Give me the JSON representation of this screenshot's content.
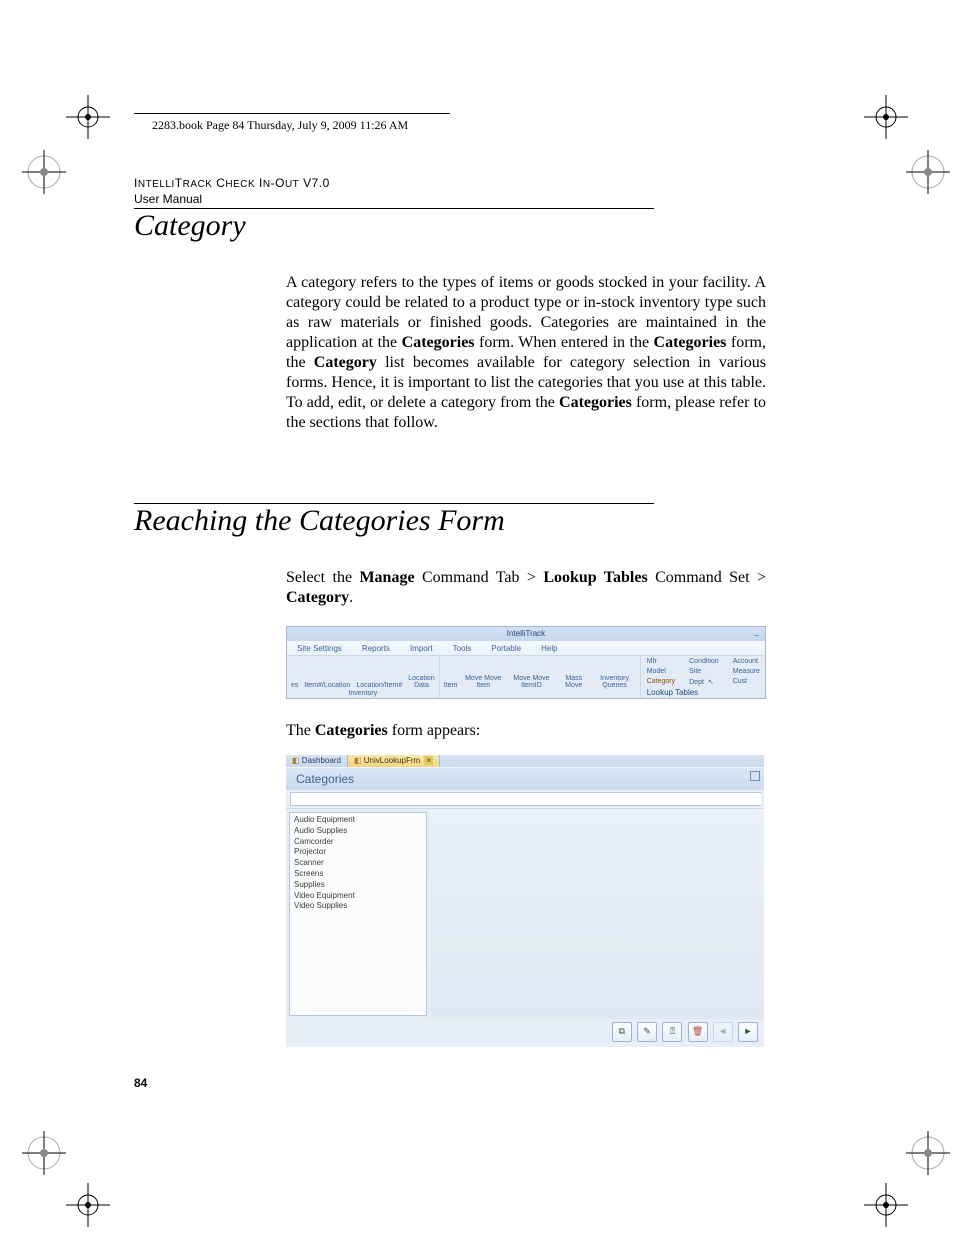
{
  "page_meta": {
    "book_line": "2283.book  Page 84  Thursday, July 9, 2009  11:26 AM",
    "product": "IntelliTrack Check In-Out v7.0",
    "subtitle": "User Manual",
    "page_number": "84"
  },
  "section1": {
    "heading": "Category",
    "para_html": "A category refers to the types of items or goods stocked in your facility. A category could be related to a product type or in-stock inventory type such as raw materials or finished goods. Categories are maintained in the application at the <b>Categories</b> form. When entered in the <b>Categories</b> form, the <b>Category</b> list becomes available for category selection in various forms. Hence, it is important to list the categories that you use at this table. To add, edit, or delete a category from the <b>Categories</b> form, please refer to the sections that follow."
  },
  "section2": {
    "heading": "Reaching the Categories Form",
    "para_html": "Select the <b>Manage</b> Command Tab > <b>Lookup Tables</b> Command Set > <b>Category</b>."
  },
  "ribbon": {
    "window_title": "IntelliTrack",
    "tabs": [
      "Site Settings",
      "Reports",
      "Import",
      "Tools",
      "Portable",
      "Help"
    ],
    "group_inventory": {
      "name": "Inventory",
      "items_left": [
        "es",
        "Item#/Location",
        "Location/Item#",
        "Location Data"
      ],
      "items_right": [
        "Item",
        "Move  Move Item",
        "Move Move ItemID",
        "Mass Move",
        "Inventory Queries"
      ]
    },
    "group_lookup": {
      "name": "Lookup Tables",
      "grid": [
        [
          "Mfr",
          "Condition",
          "Account"
        ],
        [
          "Model",
          "Site",
          "Measure"
        ],
        [
          "Category",
          "Dept",
          "Cust"
        ]
      ],
      "active": "Category"
    }
  },
  "cat_form": {
    "appears_text": "The Categories form appears:",
    "tabs": [
      {
        "label": "Dashboard",
        "active": false
      },
      {
        "label": "UnivLookupFrm",
        "active": true
      }
    ],
    "title": "Categories",
    "list": [
      "Audio Equipment",
      "Audio Supplies",
      "Camcorder",
      "Projector",
      "Scanner",
      "Screens",
      "Supplies",
      "Video Equipment",
      "Video Supplies"
    ],
    "footer_buttons": [
      "first-record-icon",
      "prev-record-icon",
      "edit-icon",
      "delete-icon",
      "next-record-icon",
      "last-record-icon"
    ]
  }
}
